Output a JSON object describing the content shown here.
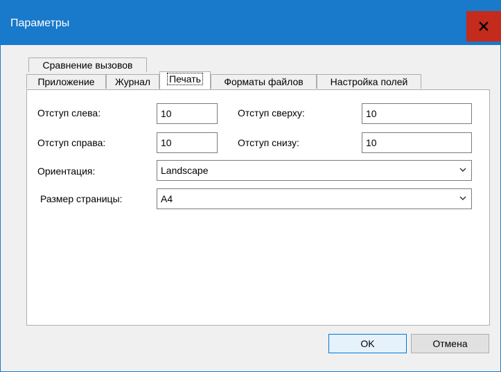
{
  "window": {
    "title": "Параметры"
  },
  "tabs": {
    "row1": [
      {
        "label": "Сравнение вызовов"
      }
    ],
    "row2": [
      {
        "label": "Приложение"
      },
      {
        "label": "Журнал"
      },
      {
        "label": "Печать",
        "active": true
      },
      {
        "label": "Форматы файлов"
      },
      {
        "label": "Настройка полей"
      }
    ]
  },
  "print": {
    "margin_left_label": "Отступ слева:",
    "margin_left_value": "10",
    "margin_top_label": "Отступ сверху:",
    "margin_top_value": "10",
    "margin_right_label": "Отступ справа:",
    "margin_right_value": "10",
    "margin_bottom_label": "Отступ снизу:",
    "margin_bottom_value": "10",
    "orientation_label": "Ориентация:",
    "orientation_value": "Landscape",
    "page_size_label": "Размер страницы:",
    "page_size_value": "A4"
  },
  "buttons": {
    "ok": "OK",
    "cancel": "Отмена"
  },
  "icons": {
    "close": "close-icon",
    "dropdown": "chevron-down-icon"
  },
  "colors": {
    "titlebar": "#1979ca",
    "close": "#c42b1c",
    "dialog_bg": "#f0f0f0"
  }
}
